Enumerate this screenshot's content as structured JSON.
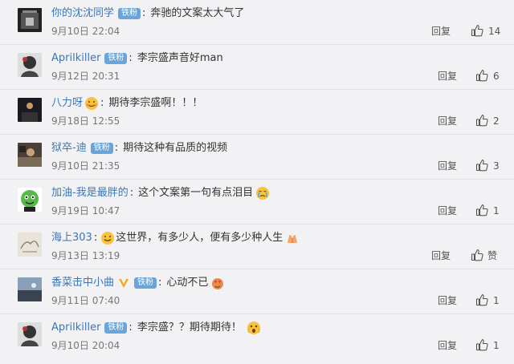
{
  "comments": [
    {
      "user": "你的沈沈同学",
      "badge": "铁粉",
      "text": "奔驰的文案太大气了",
      "time": "9月10日 22:04",
      "reply": "回复",
      "likes": "14",
      "avatar": "avatar-night-photo"
    },
    {
      "user": "Aprilkiller",
      "badge": "铁粉",
      "text": "李宗盛声音好man",
      "time": "9月12日 20:31",
      "reply": "回复",
      "likes": "6",
      "avatar": "avatar-portrait"
    },
    {
      "user": "八力呀",
      "badge": "",
      "text": "期待李宗盛啊！！！",
      "time": "9月18日 12:55",
      "reply": "回复",
      "likes": "2",
      "avatar": "avatar-dark-scene"
    },
    {
      "user": "狱卒-迪",
      "badge": "铁粉",
      "text": "期待这种有品质的视频",
      "time": "9月10日 21:35",
      "reply": "回复",
      "likes": "3",
      "avatar": "avatar-room"
    },
    {
      "user": "加油-我是最胖的",
      "badge": "",
      "text": "这个文案第一句有点泪目",
      "time": "9月19日 10:47",
      "reply": "回复",
      "likes": "1",
      "avatar": "avatar-green-cartoon"
    },
    {
      "user": "海上303",
      "badge": "",
      "text": "这世界，有多少人，便有多少种人生",
      "time": "9月13日 13:19",
      "reply": "回复",
      "likes": "赞",
      "avatar": "avatar-sketch"
    },
    {
      "user": "香菜击中小曲",
      "badge": "铁粉",
      "text": "心动不已",
      "time": "9月11日 07:40",
      "reply": "回复",
      "likes": "1",
      "avatar": "avatar-landscape"
    },
    {
      "user": "Aprilkiller",
      "badge": "铁粉",
      "text": "李宗盛？？期待期待！",
      "time": "9月10日 20:04",
      "reply": "回复",
      "likes": "1",
      "avatar": "avatar-portrait"
    }
  ],
  "colors": {
    "username": "#3b76b7",
    "badge": "#6aa4d8",
    "background": "#f2f2f5"
  }
}
